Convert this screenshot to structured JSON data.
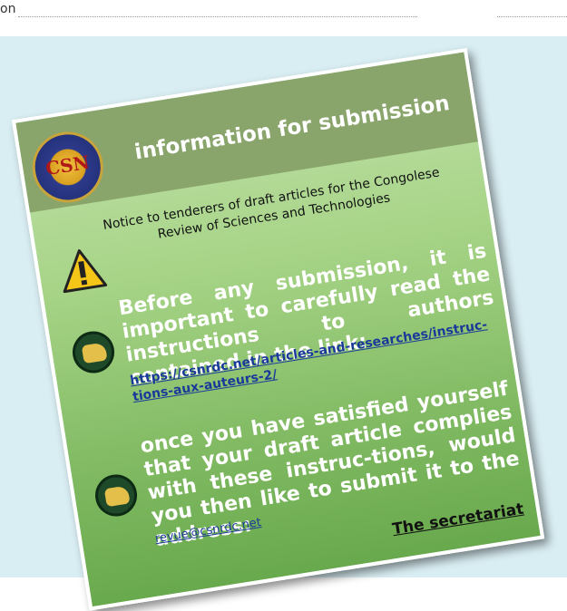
{
  "header": {
    "leading_text": "on",
    "gap_before_page_edge": ""
  },
  "card": {
    "seal_letters": "CSN",
    "title": "information for submission",
    "notice": "Notice to tenderers of draft articles for the Congolese Review of Sciences and Technologies",
    "paragraph1": "Before any submission, it is important to carefully read the instructions to authors contained in the link:",
    "link1": "https://csnrdc.net/articles-and-researches/instruc-tions-aux-auteurs-2/",
    "paragraph2": "once you have satisfied yourself that your draft article complies with these instruc-tions, would you then like to submit it to the address:",
    "link2": "revue@csnrdc.net",
    "signature": "The secretariat"
  },
  "icons": {
    "warning": "warning-triangle-icon",
    "bullet1": "pointing-hand-icon",
    "bullet2": "pointing-hand-icon",
    "seal": "organization-seal-icon"
  },
  "colors": {
    "card_gradient_top": "#bfe0a8",
    "card_gradient_bottom": "#69a94d",
    "header_band": "#8aa56b",
    "page_panel": "#d9eef3",
    "link": "#1a3a9a"
  }
}
